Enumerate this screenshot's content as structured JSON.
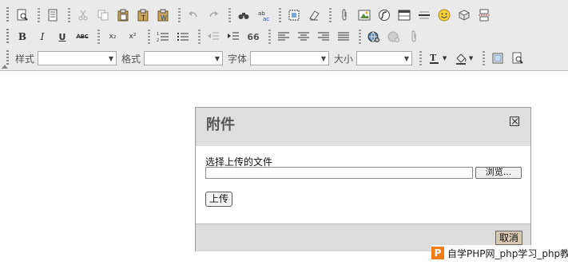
{
  "toolbar": {
    "style_label": "样式",
    "format_label": "格式",
    "font_label": "字体",
    "size_label": "大小",
    "bold_glyph": "B",
    "italic_glyph": "I",
    "underline_glyph": "U",
    "strike_glyph": "ABC",
    "subscript_glyph": "x₂",
    "superscript_glyph": "x²",
    "quote_glyph": "66",
    "style_value": "",
    "format_value": "",
    "font_value": "",
    "size_value": ""
  },
  "dialog": {
    "title": "附件",
    "file_label": "选择上传的文件",
    "browse_label": "浏览...",
    "upload_label": "上传",
    "cancel_label": "取消",
    "file_value": ""
  },
  "watermark": {
    "logo": "P",
    "text": "自学PHP网_php学习_php教"
  },
  "colors": {
    "toolbar_bg": "#eaeaea",
    "dialog_header_bg": "#dfdfdf",
    "cancel_bg": "#d6c7b0",
    "watermark_logo": "#f07d1a"
  }
}
